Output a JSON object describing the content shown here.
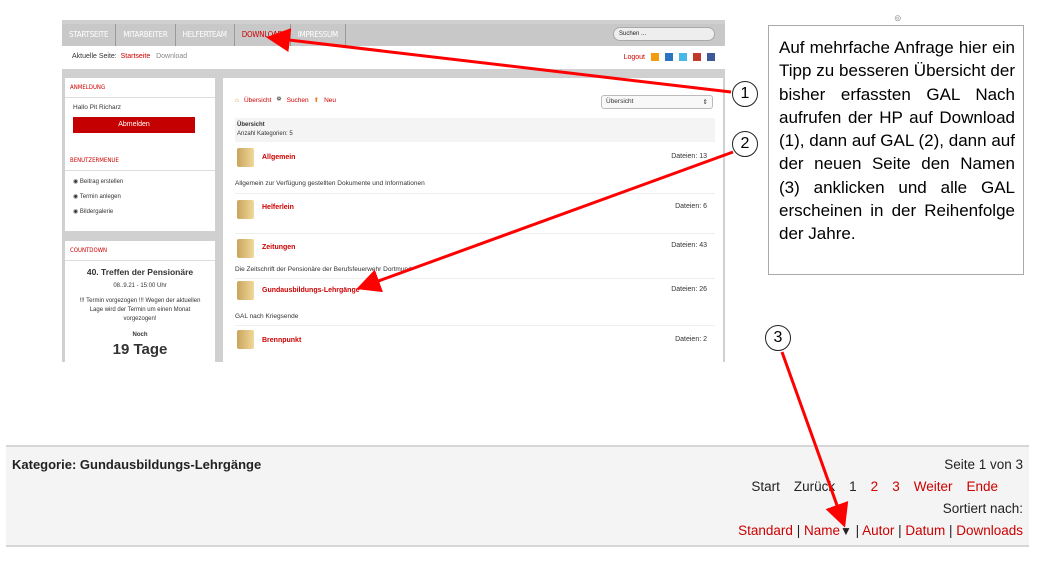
{
  "site": {
    "nav": [
      "STARTSEITE",
      "MITARBEITER",
      "HELFERTEAM",
      "DOWNLOAD",
      "IMPRESSUM"
    ],
    "search_placeholder": "Suchen ...",
    "breadcrumb": {
      "label": "Aktuelle Seite:",
      "home": "Startseite",
      "current": "Download"
    },
    "logout": "Logout",
    "login_panel": {
      "title": "ANMELDUNG",
      "greeting": "Hallo Pit Richarz",
      "button": "Abmelden"
    },
    "user_menu": {
      "title": "BENUTZERMENUE",
      "items": [
        "Beitrag erstellen",
        "Termin anlegen",
        "Bildergalerie"
      ]
    },
    "countdown": {
      "title": "COUNTDOWN",
      "event": "40. Treffen der Pensionäre",
      "date": "08..9.21 - 15:00 Uhr",
      "notice": "!!! Termin vorgezogen !!! Wegen der aktuellen Lage wird der Termin um einen Monat vorgezogen!",
      "noch": "Noch",
      "days": "19 Tage"
    },
    "toolbar": {
      "overview": "Übersicht",
      "search": "Suchen",
      "new": "Neu",
      "select": "Übersicht"
    },
    "overview": {
      "title": "Übersicht",
      "count": "Anzahl Kategorien: 5"
    },
    "categories": [
      {
        "name": "Allgemein",
        "files": "Dateien: 13",
        "desc": "Allgemein zur Verfügung gestellten Dokumente und Informationen"
      },
      {
        "name": "Helferlein",
        "files": "Dateien: 6",
        "desc": ""
      },
      {
        "name": "Zeitungen",
        "files": "Dateien: 43",
        "desc": "Die Zeitschrift der Pensionäre der Berufsfeuerwehr Dortmund"
      },
      {
        "name": "Gundausbildungs-Lehrgänge",
        "files": "Dateien: 26",
        "desc": "GAL nach Kriegsende"
      },
      {
        "name": "Brennpunkt",
        "files": "Dateien: 2",
        "desc": ""
      }
    ]
  },
  "note": "Auf mehrfache Anfrage hier ein Tipp zu besseren Übersicht der bisher erfassten GAL Nach aufrufen der HP auf Download (1), dann auf GAL (2), dann auf der neuen Seite den Namen (3) anklicken und alle GAL erscheinen in der Reihenfolge der Jahre.",
  "markers": [
    "1",
    "2",
    "3"
  ],
  "bottom": {
    "category": "Kategorie: Gundausbildungs-Lehrgänge",
    "page": "Seite 1 von 3",
    "pager": {
      "start": "Start",
      "back": "Zurück",
      "p1": "1",
      "p2": "2",
      "p3": "3",
      "next": "Weiter",
      "end": "Ende"
    },
    "sort_label": "Sortiert nach:",
    "sort": [
      "Standard",
      "Name",
      "Autor",
      "Datum",
      "Downloads"
    ]
  },
  "colors": {
    "accent": "#cc0000",
    "arrow": "#ff0000"
  }
}
